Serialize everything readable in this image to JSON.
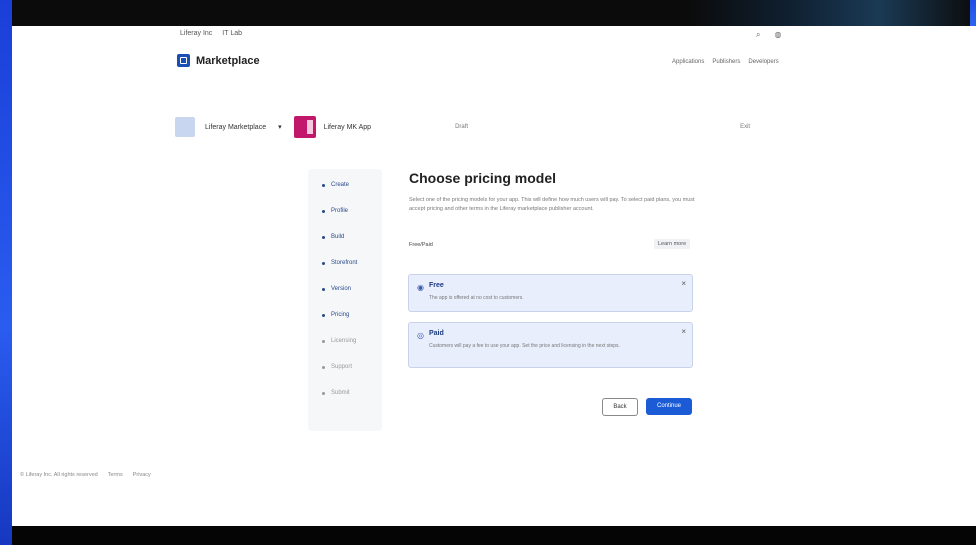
{
  "top_nav": {
    "items": [
      "Liferay Inc",
      "IT Lab"
    ]
  },
  "top_right": {
    "search_icon": "search-icon",
    "user_icon": "user-icon"
  },
  "brand": {
    "name": "Marketplace"
  },
  "account_links": [
    "Applications",
    "Publishers",
    "Developers"
  ],
  "app_bar": {
    "account_name": "Liferay Marketplace",
    "app_name": "Liferay MK App",
    "status": "Draft",
    "exit_label": "Exit"
  },
  "steps": [
    {
      "label": "Create"
    },
    {
      "label": "Profile"
    },
    {
      "label": "Build"
    },
    {
      "label": "Storefront"
    },
    {
      "label": "Version"
    },
    {
      "label": "Pricing"
    },
    {
      "label": "Licensing"
    },
    {
      "label": "Support"
    },
    {
      "label": "Submit"
    }
  ],
  "main": {
    "title": "Choose pricing model",
    "description": "Select one of the pricing models for your app. This will define how much users will pay. To select paid plans, you must accept pricing and other terms in the Liferay marketplace publisher account.",
    "sub_label": "Free/Paid",
    "learn_more": "Learn more",
    "options": [
      {
        "label": "Free",
        "description": "The app is offered at no cost to customers."
      },
      {
        "label": "Paid",
        "description": "Customers will pay a fee to use your app. Set the price and licensing in the next steps."
      }
    ]
  },
  "buttons": {
    "back": "Back",
    "continue": "Continue"
  },
  "footer": {
    "items": [
      "© Liferay Inc. All rights reserved",
      "Terms",
      "Privacy"
    ]
  }
}
